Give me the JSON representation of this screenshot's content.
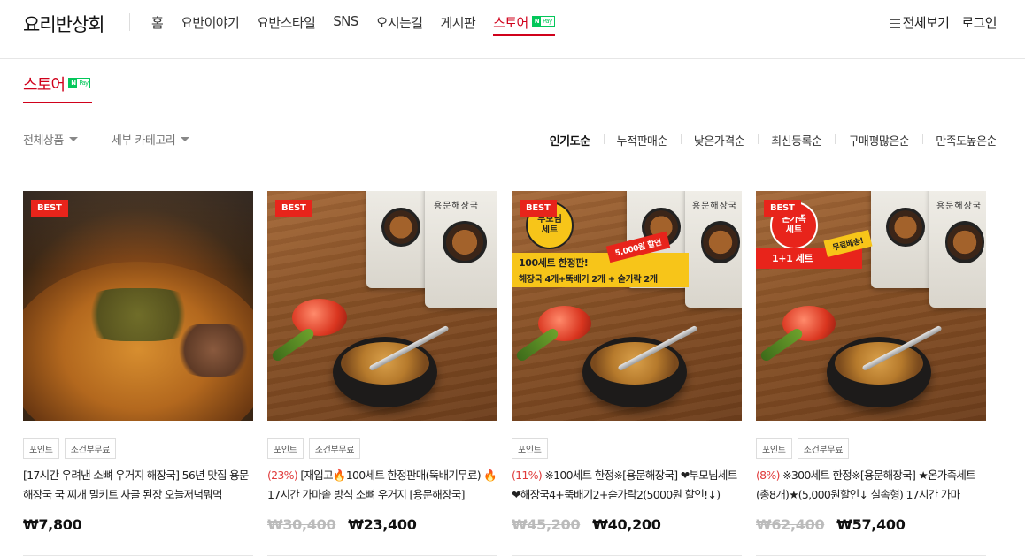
{
  "header": {
    "brand": "요리반상회",
    "nav": [
      "홈",
      "요반이야기",
      "요반스타일",
      "SNS",
      "오시는길",
      "게시판",
      "스토어"
    ],
    "active_nav": "스토어",
    "all_view": "전체보기",
    "login": "로그인"
  },
  "npay": {
    "n": "N",
    "pay": "Pay"
  },
  "store": {
    "title": "스토어"
  },
  "filters": {
    "all_products": "전체상품",
    "sub_category": "세부 카테고리"
  },
  "sorts": [
    "인기도순",
    "누적판매순",
    "낮은가격순",
    "최신등록순",
    "구매평많은순",
    "만족도높은순"
  ],
  "active_sort": "인기도순",
  "products": [
    {
      "badge": "BEST",
      "tags": [
        "포인트",
        "조건부무료"
      ],
      "discount": "",
      "title": "[17시간 우려낸 소뼈 우거지 해장국] 56년 맛집 용문해장국 국 찌개 밀키트 사골 된장 오늘저녁뭐먹",
      "old_price": "",
      "price": "₩7,800"
    },
    {
      "badge": "BEST",
      "tags": [
        "포인트",
        "조건부무료"
      ],
      "discount": "(23%)",
      "title": " [재입고🔥100세트 한정판매(뚝배기무료) 🔥 17시간 가마솥 방식 소뼈 우거지 [용문해장국]",
      "old_price": "₩30,400",
      "price": "₩23,400",
      "pouch_label": "용문해장국"
    },
    {
      "badge": "BEST",
      "tags": [
        "포인트"
      ],
      "discount": "(11%)",
      "title": " ※100세트 한정※[용문해장국] ❤부모님세트❤해장국4+뚝배기2+숟가락2(5000원 할인!↓)",
      "old_price": "₩45,200",
      "price": "₩40,200",
      "pouch_label": "용문해장국",
      "circle": "부모님\n세트",
      "banner1": "100세트 한정판!",
      "banner2": "해장국 4개+뚝배기 2개 + 숟가락 2개",
      "ribbon": "5,000원 할인"
    },
    {
      "badge": "BEST",
      "tags": [
        "포인트",
        "조건부무료"
      ],
      "discount": "(8%)",
      "title": " ※300세트 한정※[용문해장국] ★온가족세트(총8개)★(5,000원할인↓ 실속형) 17시간 가마",
      "old_price": "₩62,400",
      "price": "₩57,400",
      "pouch_label": "용문해장국",
      "circle": "온가족\n세트",
      "banner1": "1+1 세트",
      "ribbon": "무료배송!"
    }
  ],
  "colors": {
    "accent": "#d0011b",
    "npay": "#03c75a",
    "best": "#e8241b"
  }
}
